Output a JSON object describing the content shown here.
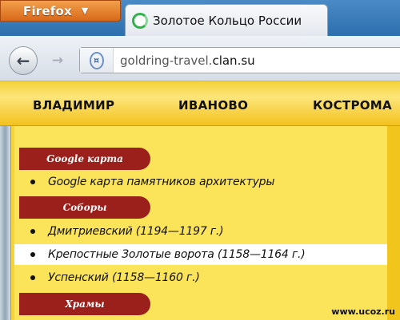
{
  "browser": {
    "menu_button_label": "Firefox",
    "tab_title": "Золотое Кольцо России",
    "url_host_prefix": "goldring-travel.",
    "url_host_domain": "clan.su"
  },
  "topnav": {
    "items": [
      "ВЛАДИМИР",
      "ИВАНОВО",
      "КОСТРОМА"
    ]
  },
  "sections": [
    {
      "heading": "Google карта",
      "links": [
        "Google карта памятников архитектуры"
      ]
    },
    {
      "heading": "Соборы",
      "links": [
        "Дмитриевский (1194—1197 г.)",
        "Крепостные Золотые ворота (1158—1164 г.)",
        "Успенский (1158—1160 г.)"
      ]
    },
    {
      "heading": "Храмы",
      "links": []
    }
  ],
  "watermark": "www.ucoz.ru"
}
